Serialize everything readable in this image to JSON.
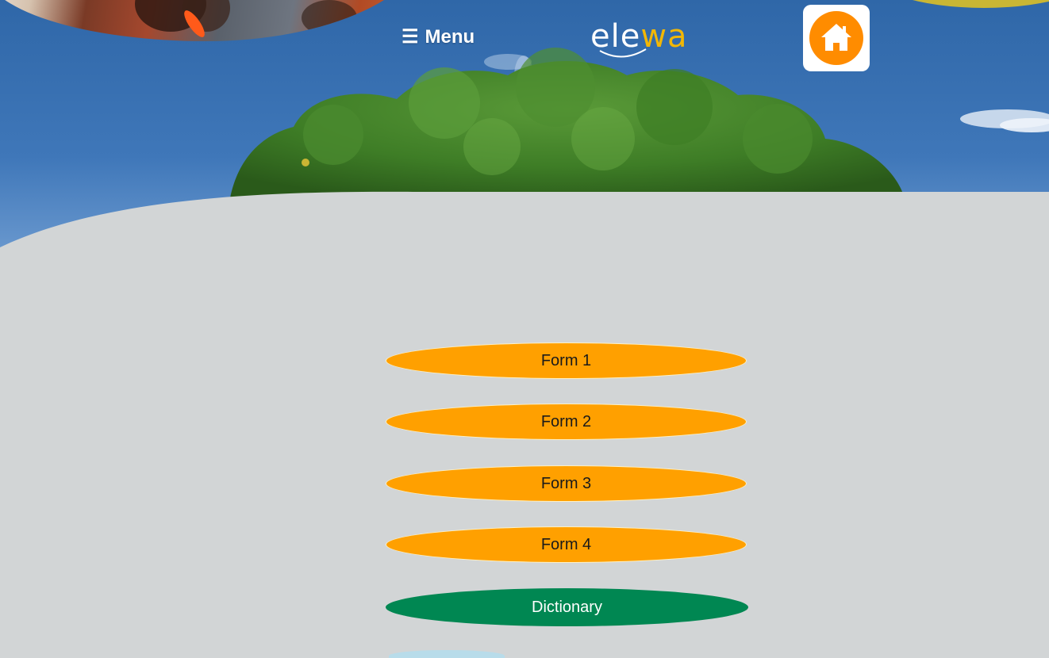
{
  "header": {
    "menu_icon": "☰",
    "menu_label": "Menu",
    "logo_part1": "ele",
    "logo_part2": "wa",
    "home_icon": "home-icon"
  },
  "forms": [
    {
      "label": "Form 1"
    },
    {
      "label": "Form 2"
    },
    {
      "label": "Form 3"
    },
    {
      "label": "Form 4"
    }
  ],
  "dictionary": {
    "label": "Dictionary"
  },
  "colors": {
    "background": "#d2d5d6",
    "form_button": "#ffa000",
    "dictionary_button": "#008752",
    "home_circle": "#ff8c00",
    "logo_accent": "#f2b705"
  }
}
